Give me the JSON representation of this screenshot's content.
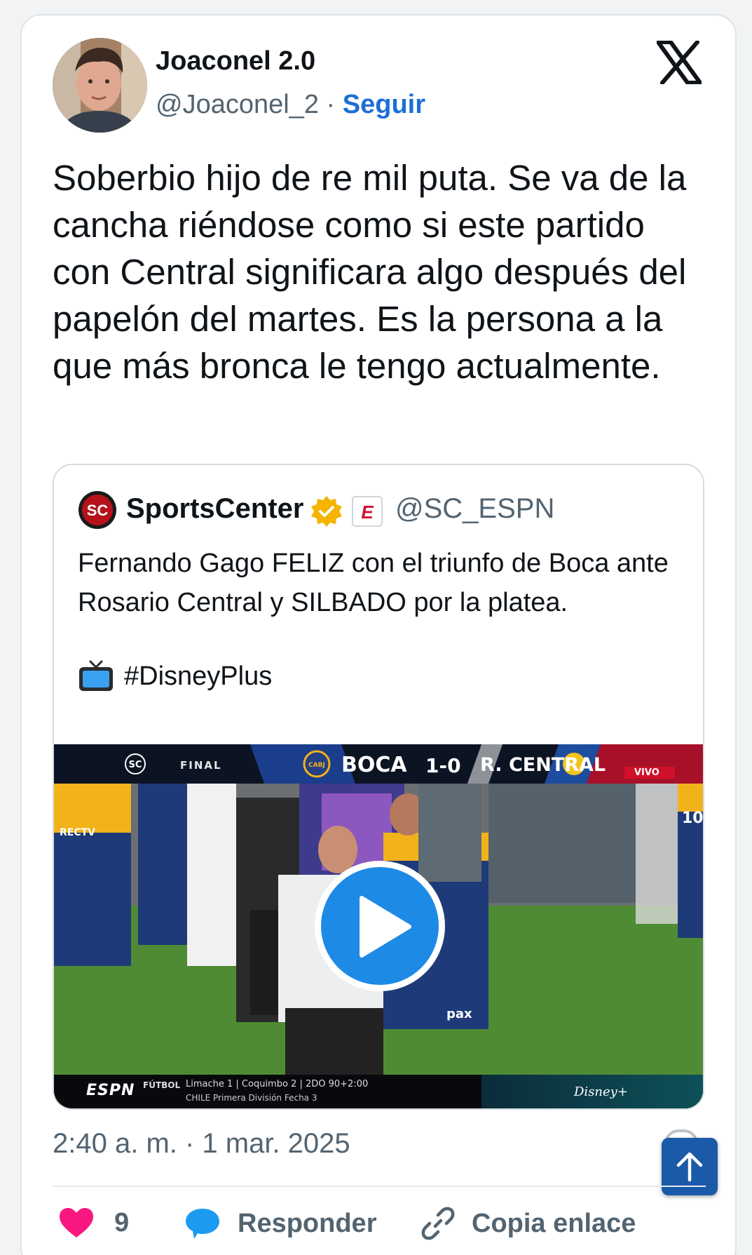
{
  "author": {
    "name": "Joaconel 2.0",
    "handle": "@Joaconel_2",
    "separator": "·",
    "follow_label": "Seguir"
  },
  "tweet": {
    "text": "Soberbio hijo de re mil puta. Se va de la cancha riéndose como si este partido con Central significara algo después del papelón del martes. Es la persona a la que más bronca le tengo actualmente.",
    "timestamp": "2:40 a. m. · 1 mar. 2025"
  },
  "quoted": {
    "name": "SportsCenter",
    "handle": "@SC_ESPN",
    "text": "Fernando Gago FELIZ con el triunfo de Boca ante Rosario Central y SILBADO por la platea.",
    "hashtag": "#DisneyPlus",
    "avatar_label": "SC",
    "espn_badge": "E",
    "video": {
      "scorebar": {
        "status": "FINAL",
        "home": "BOCA",
        "score": "1-0",
        "away": "R. CENTRAL",
        "live": "VIVO",
        "home_badge": "CABJ",
        "logo": "SC"
      },
      "ticker": {
        "network": "ESPN",
        "sport": "FÚTBOL",
        "match": "Limache       1 | Coquimbo       2 | 2DO 90+2:00",
        "league": "CHILE   Primera División   Fecha 3",
        "brand": "Disney+"
      },
      "jersey_text": "RECTV",
      "sponsor_text": "pax",
      "player_number": "10"
    }
  },
  "actions": {
    "likes_count": "9",
    "reply_label": "Responder",
    "copy_label": "Copia enlace"
  },
  "colors": {
    "accent": "#1d6fd6",
    "like": "#f91880",
    "reply": "#1d9bf0",
    "scroll_button": "#1a5aa8",
    "text_secondary": "#536471"
  },
  "icons": {
    "brand": "x-logo-icon",
    "verified": "verified-badge-icon",
    "tv": "television-icon",
    "play": "play-icon",
    "like": "heart-icon",
    "reply": "speech-bubble-icon",
    "copy": "link-icon",
    "scroll": "arrow-up-icon"
  }
}
